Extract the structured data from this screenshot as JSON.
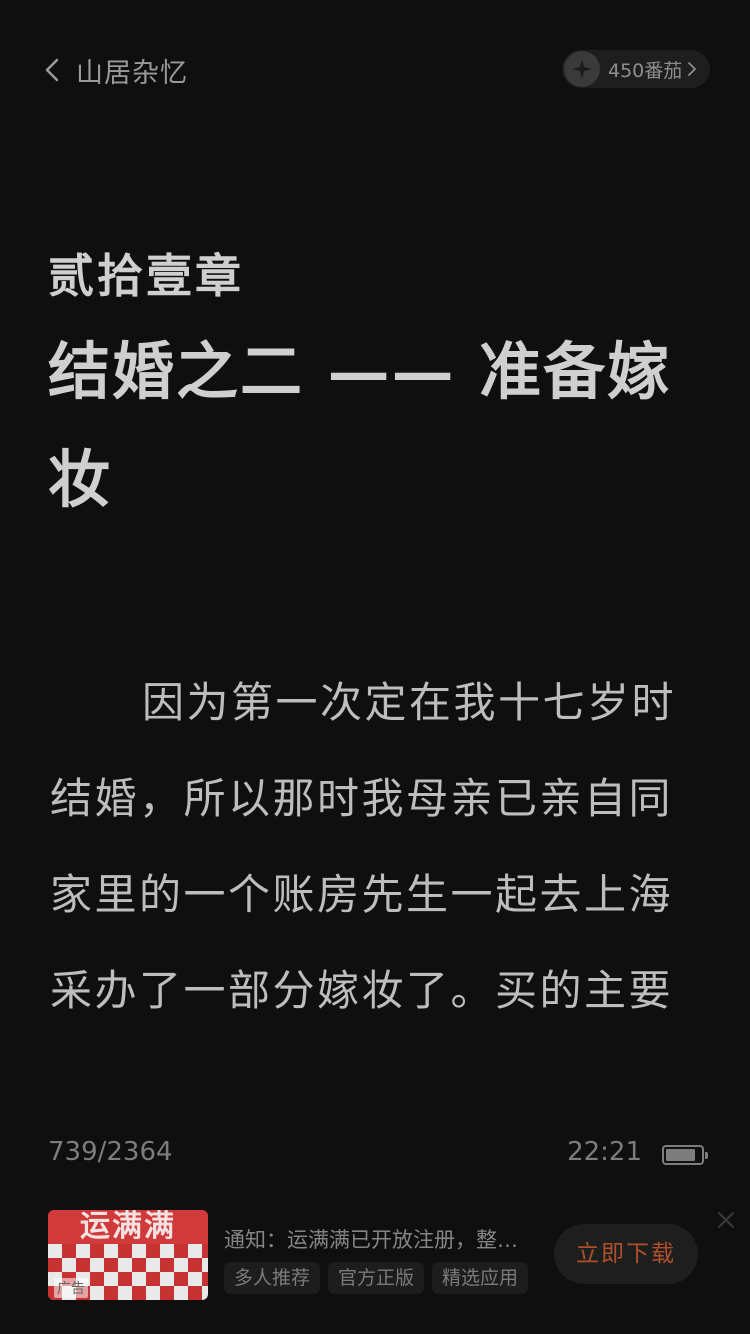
{
  "header": {
    "book_title": "山居杂忆",
    "coins_label": "450番茄",
    "icons": {
      "back": "chevron-left-icon",
      "coin": "sparkle-coin-icon",
      "more": "chevron-right-icon"
    }
  },
  "chapter": {
    "number": "贰拾壹章",
    "title": "结婚之二 —— 准备嫁妆",
    "body": "因为第一次定在我十七岁时结婚，所以那时我母亲已亲自同家里的一个账房先生一起去上海采办了一部分嫁妆了。买的主要"
  },
  "status": {
    "progress": "739/2364",
    "time": "22:21",
    "battery_level": 0.85
  },
  "ad": {
    "thumb_text": "运满满",
    "tag": "广告",
    "text": "通知：运满满已开放注册，整车货源，全国通用",
    "chips": [
      "多人推荐",
      "官方正版",
      "精选应用"
    ],
    "cta": "立即下载",
    "colors": {
      "cta": "#b0502a",
      "thumb": "#c73333"
    }
  }
}
